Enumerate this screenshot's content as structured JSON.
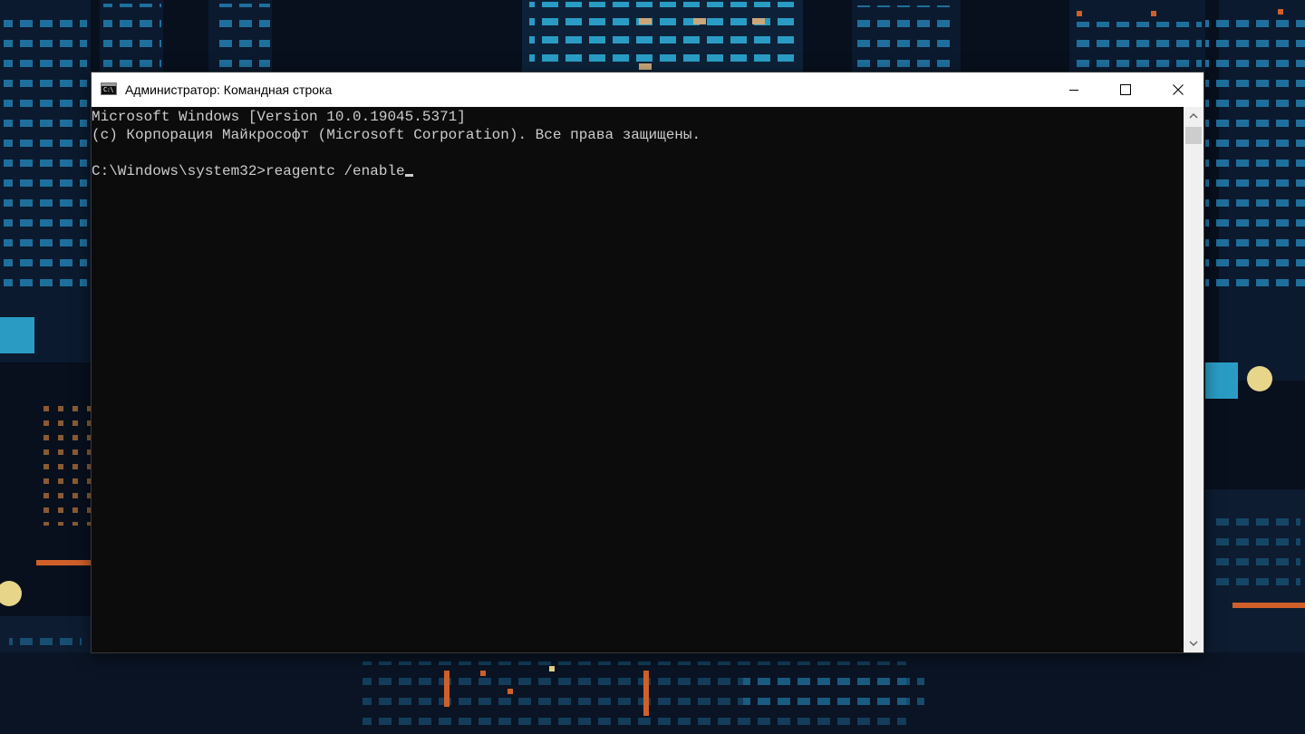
{
  "window": {
    "title": "Администратор: Командная строка",
    "icon": "cmd-icon"
  },
  "caption_buttons": {
    "minimize": "minimize-icon",
    "maximize": "maximize-icon",
    "close": "close-icon"
  },
  "console": {
    "lines": [
      "Microsoft Windows [Version 10.0.19045.5371]",
      "(c) Корпорация Майкрософт (Microsoft Corporation). Все права защищены.",
      ""
    ],
    "prompt": "C:\\Windows\\system32>",
    "command": "reagentc /enable",
    "text_color": "#cccccc",
    "background": "#0c0c0c"
  },
  "scrollbar": {
    "up_icon": "chevron-up-icon",
    "down_icon": "chevron-down-icon"
  }
}
